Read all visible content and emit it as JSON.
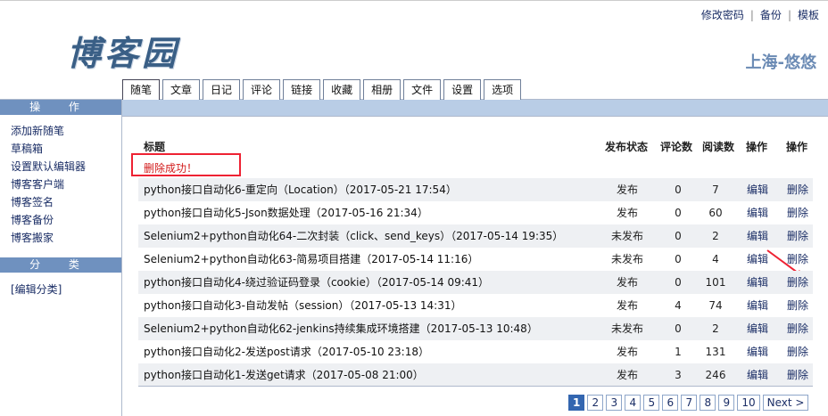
{
  "header": {
    "logo": "博客园",
    "links": [
      "修改密码",
      "备份",
      "模板"
    ],
    "username": "上海-悠悠"
  },
  "tabs": [
    "随笔",
    "文章",
    "日记",
    "评论",
    "链接",
    "收藏",
    "相册",
    "文件",
    "设置",
    "选项"
  ],
  "sidebar": {
    "ops_title": "操 作",
    "ops": [
      "添加新随笔",
      "草稿箱",
      "设置默认编辑器",
      "博客客户端",
      "博客签名",
      "博客备份",
      "博客搬家"
    ],
    "cat_title": "分 类",
    "cat_link": "[编辑分类]"
  },
  "table": {
    "headers": {
      "title": "标题",
      "status": "发布状态",
      "comments": "评论数",
      "reads": "阅读数",
      "op1": "操作",
      "op2": "操作"
    },
    "message": "删除成功！",
    "rows": [
      {
        "title": "python接口自动化6-重定向（Location）（2017-05-21 17:54）",
        "status": "发布",
        "comments": "0",
        "reads": "7",
        "edit": "编辑",
        "del": "删除"
      },
      {
        "title": "python接口自动化5-Json数据处理（2017-05-16 21:34）",
        "status": "发布",
        "comments": "0",
        "reads": "60",
        "edit": "编辑",
        "del": "删除"
      },
      {
        "title": "Selenium2+python自动化64-二次封装（click、send_keys）（2017-05-14 19:35）",
        "status": "未发布",
        "comments": "0",
        "reads": "2",
        "edit": "编辑",
        "del": "删除"
      },
      {
        "title": "Selenium2+python自动化63-简易项目搭建（2017-05-14 11:16）",
        "status": "未发布",
        "comments": "0",
        "reads": "4",
        "edit": "编辑",
        "del": "删除"
      },
      {
        "title": "python接口自动化4-绕过验证码登录（cookie）（2017-05-14 09:41）",
        "status": "发布",
        "comments": "0",
        "reads": "101",
        "edit": "编辑",
        "del": "删除"
      },
      {
        "title": "python接口自动化3-自动发帖（session）（2017-05-13 14:31）",
        "status": "发布",
        "comments": "4",
        "reads": "74",
        "edit": "编辑",
        "del": "删除"
      },
      {
        "title": "Selenium2+python自动化62-jenkins持续集成环境搭建（2017-05-13 10:48）",
        "status": "未发布",
        "comments": "0",
        "reads": "2",
        "edit": "编辑",
        "del": "删除"
      },
      {
        "title": "python接口自动化2-发送post请求（2017-05-10 23:18）",
        "status": "发布",
        "comments": "1",
        "reads": "131",
        "edit": "编辑",
        "del": "删除"
      },
      {
        "title": "python接口自动化1-发送get请求（2017-05-08 21:00）",
        "status": "发布",
        "comments": "3",
        "reads": "246",
        "edit": "编辑",
        "del": "删除"
      }
    ]
  },
  "pager": {
    "pages": [
      "1",
      "2",
      "3",
      "4",
      "5",
      "6",
      "7",
      "8",
      "9",
      "10"
    ],
    "next": "Next >",
    "current": "1"
  },
  "colors": {
    "accent": "#3366b0",
    "side_head": "#6f91bf",
    "bar": "#b9cde6",
    "msg": "#d21a1a"
  }
}
